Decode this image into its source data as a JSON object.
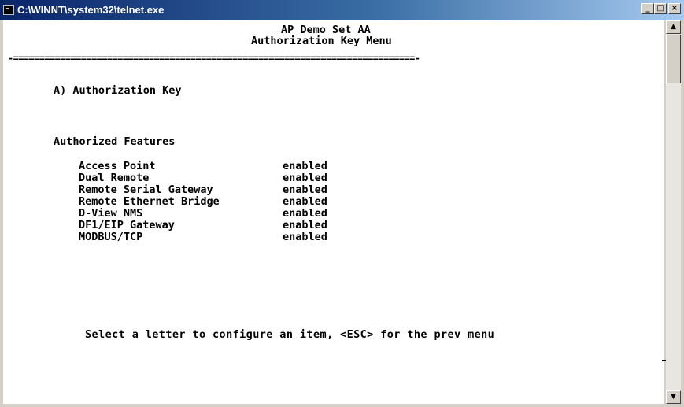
{
  "window": {
    "title": "C:\\WINNT\\system32\\telnet.exe",
    "controls": [
      "_",
      "□",
      "×"
    ]
  },
  "header": {
    "device_name": "AP Demo Set AA",
    "menu_title": "Authorization Key Menu",
    "separator": "-=============================================================================-"
  },
  "menu": {
    "item_a": "A) Authorization Key"
  },
  "features": {
    "heading": "Authorized Features",
    "items": [
      {
        "name": "Access Point",
        "status": "enabled"
      },
      {
        "name": "Dual Remote",
        "status": "enabled"
      },
      {
        "name": "Remote Serial Gateway",
        "status": "enabled"
      },
      {
        "name": "Remote Ethernet Bridge",
        "status": "enabled"
      },
      {
        "name": "D-View NMS",
        "status": "enabled"
      },
      {
        "name": "DF1/EIP Gateway",
        "status": "enabled"
      },
      {
        "name": "MODBUS/TCP",
        "status": "enabled"
      }
    ]
  },
  "prompt": "Select a letter to configure an item, <ESC> for the prev menu",
  "scrollbar": {
    "up_glyph": "▲",
    "down_glyph": "▼"
  }
}
